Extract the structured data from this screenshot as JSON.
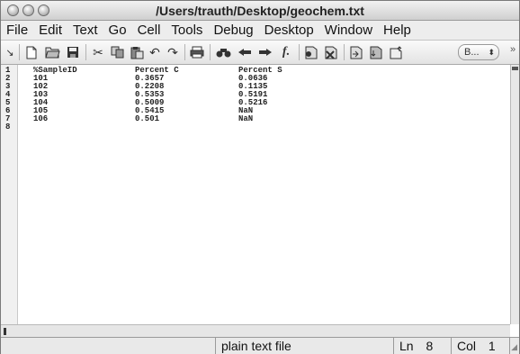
{
  "window": {
    "title": "/Users/trauth/Desktop/geochem.txt"
  },
  "menu": [
    "File",
    "Edit",
    "Text",
    "Go",
    "Cell",
    "Tools",
    "Debug",
    "Desktop",
    "Window",
    "Help"
  ],
  "toolbar": {
    "icons": [
      "expand-icon",
      "new-file-icon",
      "open-file-icon",
      "save-icon",
      "cut-icon",
      "copy-icon",
      "paste-icon",
      "undo-icon",
      "redo-icon",
      "print-icon",
      "find-icon",
      "back-icon",
      "forward-icon",
      "function-icon",
      "set-breakpoint-icon",
      "clear-breakpoints-icon",
      "step-icon",
      "step-in-icon",
      "step-out-icon"
    ],
    "select_value": "B...",
    "overflow": "»"
  },
  "editor": {
    "lines": [
      {
        "n": "1",
        "c1": "%SampleID",
        "c2": "Percent C",
        "c3": "Percent S"
      },
      {
        "n": "2",
        "c1": "101",
        "c2": "0.3657",
        "c3": "0.0636"
      },
      {
        "n": "3",
        "c1": "102",
        "c2": "0.2208",
        "c3": "0.1135"
      },
      {
        "n": "4",
        "c1": "103",
        "c2": "0.5353",
        "c3": "0.5191"
      },
      {
        "n": "5",
        "c1": "104",
        "c2": "0.5009",
        "c3": "0.5216"
      },
      {
        "n": "6",
        "c1": "105",
        "c2": "0.5415",
        "c3": "NaN"
      },
      {
        "n": "7",
        "c1": "106",
        "c2": "0.501",
        "c3": "NaN"
      },
      {
        "n": "8",
        "c1": "",
        "c2": "",
        "c3": ""
      }
    ]
  },
  "status": {
    "file_type": "plain text file",
    "ln_label": "Ln",
    "ln_value": "8",
    "col_label": "Col",
    "col_value": "1"
  }
}
